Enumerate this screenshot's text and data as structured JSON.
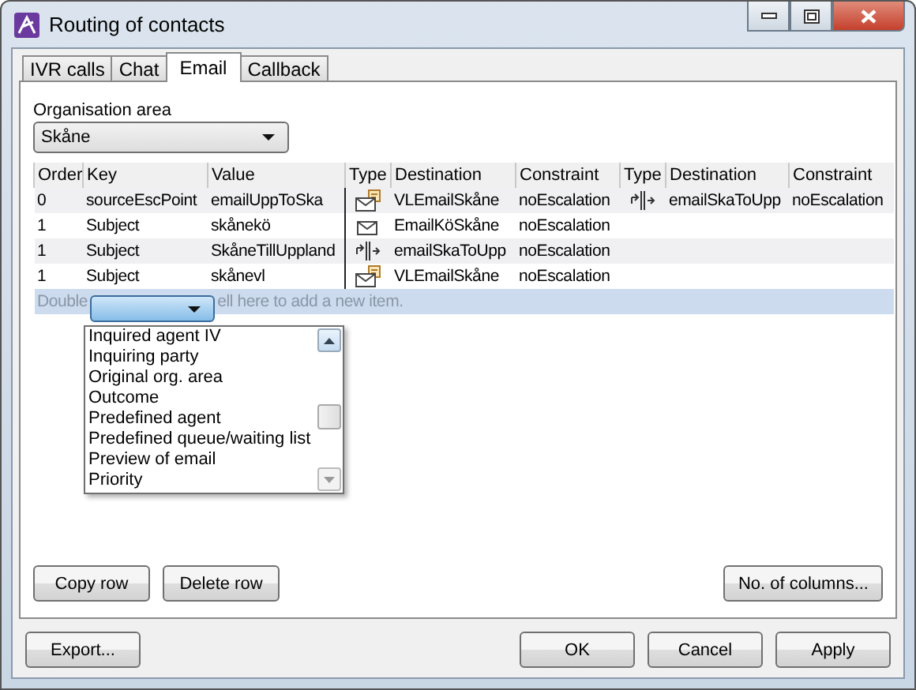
{
  "window": {
    "title": "Routing of contacts"
  },
  "tabs": [
    {
      "label": "IVR calls",
      "selected": false
    },
    {
      "label": "Chat",
      "selected": false
    },
    {
      "label": "Email",
      "selected": true
    },
    {
      "label": "Callback",
      "selected": false
    }
  ],
  "org_area": {
    "label": "Organisation area",
    "value": "Skåne"
  },
  "table": {
    "columns": [
      "Order",
      "Key",
      "Value",
      "Type",
      "Destination",
      "Constraint",
      "Type",
      "Destination",
      "Constraint"
    ],
    "rows": [
      {
        "order": "0",
        "key": "sourceEscPoint",
        "value": "emailUppToSka",
        "kind": "mail_note",
        "destination": "VLEmailSkåne",
        "constraint": "noEscalation",
        "escalation": {
          "kind": "split",
          "destination": "emailSkaToUpp",
          "constraint": "noEscalation"
        }
      },
      {
        "order": "1",
        "key": "Subject",
        "value": "skånekö",
        "kind": "mail",
        "destination": "EmailKöSkåne",
        "constraint": "noEscalation"
      },
      {
        "order": "1",
        "key": "Subject",
        "value": "SkåneTillUppland",
        "kind": "split",
        "destination": "emailSkaToUpp",
        "constraint": "noEscalation"
      },
      {
        "order": "1",
        "key": "Subject",
        "value": "skånevl",
        "kind": "mail_note",
        "destination": "VLEmailSkåne",
        "constraint": "noEscalation"
      }
    ],
    "new_row_hint_left": "Double",
    "new_row_hint_right": "ell here to add a new item."
  },
  "key_dropdown": {
    "items": [
      "Inquired agent IV",
      "Inquiring party",
      "Original org. area",
      "Outcome",
      "Predefined agent",
      "Predefined queue/waiting list",
      "Preview of email",
      "Priority"
    ]
  },
  "panel_buttons": [
    "Copy row",
    "Delete row"
  ],
  "columns_button": "No. of columns...",
  "export_button": "Export...",
  "dialog_buttons": [
    "OK",
    "Cancel",
    "Apply"
  ]
}
